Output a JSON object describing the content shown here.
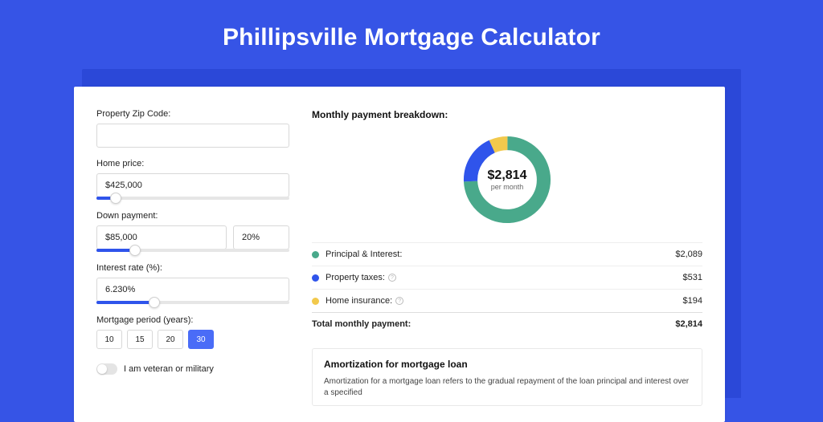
{
  "page_title": "Phillipsville Mortgage Calculator",
  "form": {
    "zip": {
      "label": "Property Zip Code:",
      "value": ""
    },
    "home_price": {
      "label": "Home price:",
      "value": "$425,000",
      "slider_pct": 10
    },
    "down_payment": {
      "label": "Down payment:",
      "value": "$85,000",
      "pct_value": "20%",
      "slider_pct": 20
    },
    "interest_rate": {
      "label": "Interest rate (%):",
      "value": "6.230%",
      "slider_pct": 30
    },
    "period": {
      "label": "Mortgage period (years):",
      "options": [
        "10",
        "15",
        "20",
        "30"
      ],
      "selected": "30"
    },
    "veteran": {
      "label": "I am veteran or military",
      "on": false
    }
  },
  "breakdown": {
    "title": "Monthly payment breakdown:",
    "donut": {
      "amount": "$2,814",
      "sub": "per month"
    },
    "items": [
      {
        "color": "#49A98B",
        "label": "Principal & Interest:",
        "info": false,
        "value": "$2,089"
      },
      {
        "color": "#2F54EB",
        "label": "Property taxes:",
        "info": true,
        "value": "$531"
      },
      {
        "color": "#F2C94C",
        "label": "Home insurance:",
        "info": true,
        "value": "$194"
      }
    ],
    "total": {
      "label": "Total monthly payment:",
      "value": "$2,814"
    }
  },
  "amortization": {
    "title": "Amortization for mortgage loan",
    "text": "Amortization for a mortgage loan refers to the gradual repayment of the loan principal and interest over a specified"
  },
  "colors": {
    "green": "#49A98B",
    "blue": "#2F54EB",
    "yellow": "#F2C94C"
  },
  "chart_data": {
    "type": "pie",
    "title": "Monthly payment breakdown",
    "series": [
      {
        "name": "Principal & Interest",
        "value": 2089,
        "color": "#49A98B"
      },
      {
        "name": "Property taxes",
        "value": 531,
        "color": "#2F54EB"
      },
      {
        "name": "Home insurance",
        "value": 194,
        "color": "#F2C94C"
      }
    ],
    "total": 2814,
    "center_label": "$2,814 per month"
  }
}
